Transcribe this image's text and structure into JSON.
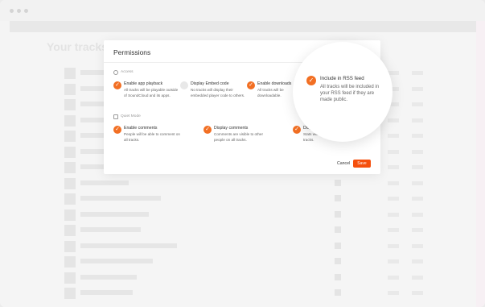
{
  "modal": {
    "title": "Permissions",
    "sections": [
      {
        "label": "Access",
        "options": [
          {
            "title": "Enable app playback",
            "desc": "All tracks will be playable outside of SoundCloud and its apps.",
            "checked": true
          },
          {
            "title": "Display Embed code",
            "desc": "No tracks will display their embedded player code to others.",
            "checked": false
          },
          {
            "title": "Enable downloads",
            "desc": "All tracks will be downloadable.",
            "checked": true
          }
        ]
      },
      {
        "label": "Quiet Mode",
        "options": [
          {
            "title": "Enable comments",
            "desc": "People will be able to comment on all tracks.",
            "checked": true
          },
          {
            "title": "Display comments",
            "desc": "Comments are visible to other people on all tracks.",
            "checked": true
          },
          {
            "title": "Display s",
            "desc": "Stats will be displayed publicly on all tracks.",
            "checked": true
          }
        ]
      }
    ],
    "cancel_label": "Cancel",
    "save_label": "Save"
  },
  "magnifier": {
    "title": "Include in RSS feed",
    "desc": "All tracks will be included in your RSS feed if they are made public.",
    "checked": true
  },
  "background": {
    "heading": "Your tracks"
  },
  "colors": {
    "accent": "#f26f23",
    "save": "#f5500e"
  }
}
